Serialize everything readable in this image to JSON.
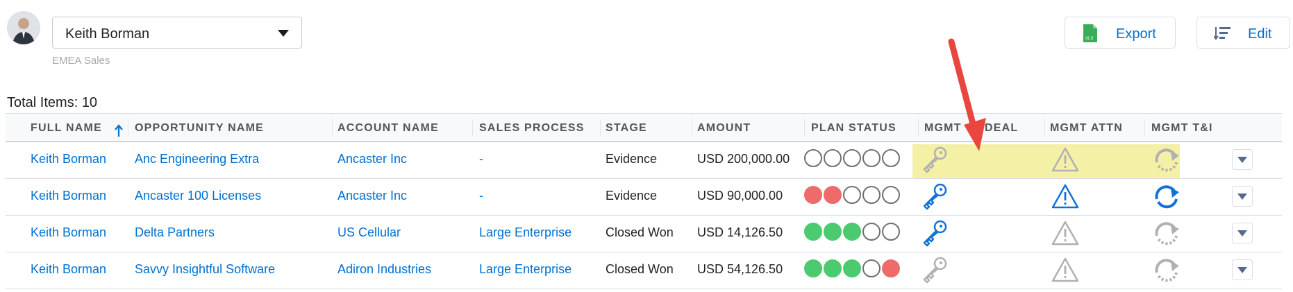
{
  "user": {
    "name": "Keith Borman",
    "team": "EMEA Sales"
  },
  "toolbar": {
    "export_label": "Export",
    "edit_label": "Edit",
    "export_badge": "XLS"
  },
  "summary": {
    "total_items": "Total Items: 10"
  },
  "columns": [
    "FULL NAME",
    "OPPORTUNITY NAME",
    "ACCOUNT NAME",
    "SALES PROCESS",
    "STAGE",
    "AMOUNT",
    "PLAN STATUS",
    "MGMT",
    "DEAL",
    "MGMT ATTN",
    "MGMT T&I"
  ],
  "rows": [
    {
      "full_name": "Keith Borman",
      "opportunity": "Anc Engineering Extra",
      "account": "Ancaster Inc",
      "sales_process": "-",
      "stage": "Evidence",
      "amount": "USD 200,000.00",
      "plan_status": [
        "empty",
        "empty",
        "empty",
        "empty",
        "empty"
      ],
      "key": "grey",
      "attn": "grey",
      "ti": "grey"
    },
    {
      "full_name": "Keith Borman",
      "opportunity": "Ancaster 100 Licenses",
      "account": "Ancaster Inc",
      "sales_process": "-",
      "stage": "Evidence",
      "amount": "USD 90,000.00",
      "plan_status": [
        "red",
        "red",
        "empty",
        "empty",
        "empty"
      ],
      "key": "blue",
      "attn": "blue",
      "ti": "blue"
    },
    {
      "full_name": "Keith Borman",
      "opportunity": "Delta Partners",
      "account": "US Cellular",
      "sales_process": "Large Enterprise",
      "stage": "Closed Won",
      "amount": "USD 14,126.50",
      "plan_status": [
        "green",
        "green",
        "green",
        "empty",
        "empty"
      ],
      "key": "blue",
      "attn": "grey",
      "ti": "grey"
    },
    {
      "full_name": "Keith Borman",
      "opportunity": "Savvy Insightful Software",
      "account": "Adiron Industries",
      "sales_process": "Large Enterprise",
      "stage": "Closed Won",
      "amount": "USD 54,126.50",
      "plan_status": [
        "green",
        "green",
        "green",
        "empty",
        "red"
      ],
      "key": "grey",
      "attn": "grey",
      "ti": "grey"
    }
  ],
  "colors": {
    "link": "#0070d2",
    "highlight": "#f4f0a6",
    "arrow": "#e8463e",
    "icon_blue": "#1172d6",
    "icon_grey": "#b0b0b0"
  }
}
